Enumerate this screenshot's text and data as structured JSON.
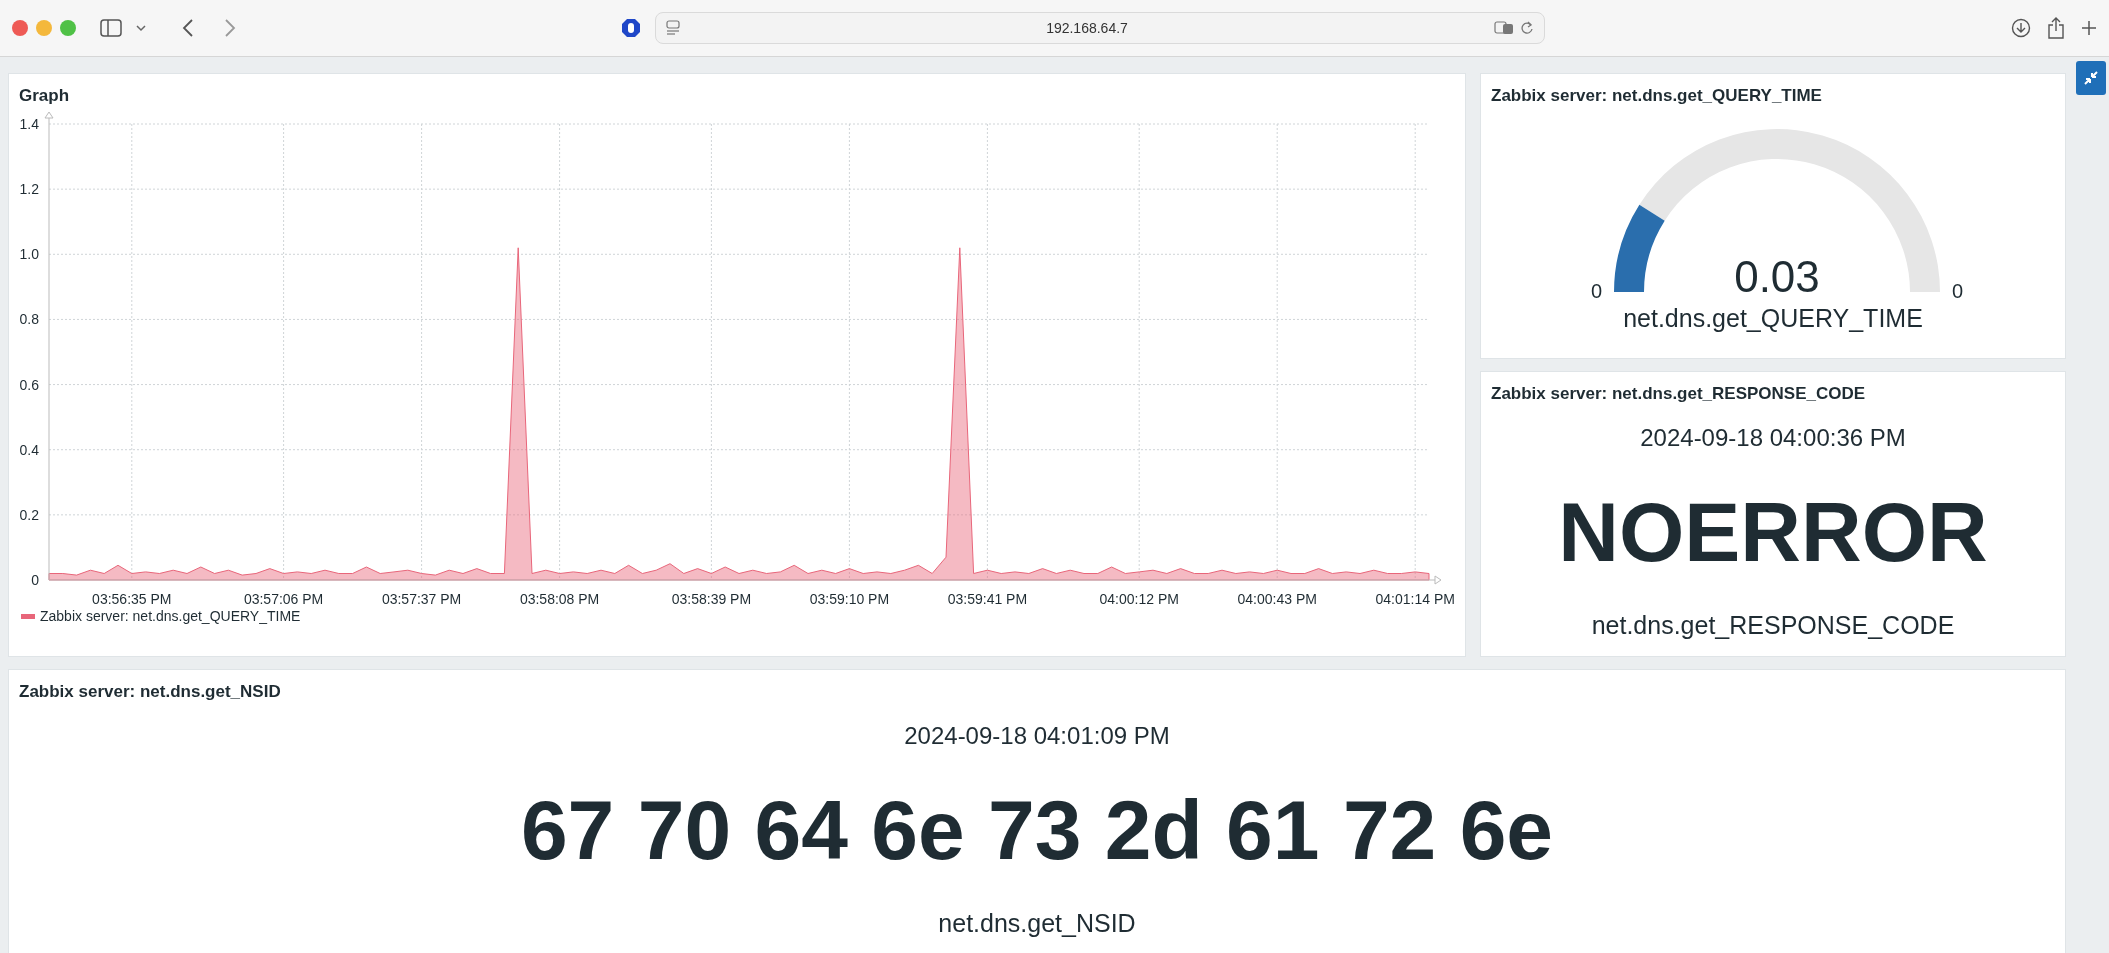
{
  "browser": {
    "url": "192.168.64.7"
  },
  "graph": {
    "title": "Graph",
    "chart_data": {
      "type": "area",
      "grid": true,
      "ylim": [
        0,
        1.4
      ],
      "categories": [
        null,
        null,
        null,
        null,
        null,
        null,
        "03:56:35 PM",
        null,
        null,
        null,
        null,
        null,
        null,
        null,
        null,
        null,
        null,
        "03:57:06 PM",
        null,
        null,
        null,
        null,
        null,
        null,
        null,
        null,
        null,
        "03:57:37 PM",
        null,
        null,
        null,
        null,
        null,
        null,
        null,
        null,
        null,
        "03:58:08 PM",
        null,
        null,
        null,
        null,
        null,
        null,
        null,
        null,
        null,
        null,
        "03:58:39 PM",
        null,
        null,
        null,
        null,
        null,
        null,
        null,
        null,
        null,
        "03:59:10 PM",
        null,
        null,
        null,
        null,
        null,
        null,
        null,
        null,
        null,
        "03:59:41 PM",
        null,
        null,
        null,
        null,
        null,
        null,
        null,
        null,
        null,
        null,
        "04:00:12 PM",
        null,
        null,
        null,
        null,
        null,
        null,
        null,
        null,
        null,
        "04:00:43 PM",
        null,
        null,
        null,
        null,
        null,
        null,
        null,
        null,
        null,
        "04:01:14 PM",
        null
      ],
      "yticks": [
        {
          "value": 0,
          "label": "0"
        },
        {
          "value": 0.2,
          "label": "0.2"
        },
        {
          "value": 0.4,
          "label": "0.4"
        },
        {
          "value": 0.6,
          "label": "0.6"
        },
        {
          "value": 0.8,
          "label": "0.8"
        },
        {
          "value": 1,
          "label": "1.0"
        },
        {
          "value": 1.2,
          "label": "1.2"
        },
        {
          "value": 1.4,
          "label": "1.4"
        }
      ],
      "series": [
        {
          "name": "Zabbix server: net.dns.get_QUERY_TIME",
          "color": "#e8667a",
          "values": [
            0.02,
            0.02,
            0.015,
            0.03,
            0.02,
            0.045,
            0.02,
            0.025,
            0.02,
            0.03,
            0.02,
            0.04,
            0.02,
            0.03,
            0.015,
            0.02,
            0.035,
            0.02,
            0.025,
            0.02,
            0.03,
            0.02,
            0.02,
            0.04,
            0.02,
            0.025,
            0.03,
            0.02,
            0.015,
            0.03,
            0.02,
            0.035,
            0.02,
            0.02,
            1.02,
            0.02,
            0.03,
            0.02,
            0.025,
            0.02,
            0.03,
            0.02,
            0.045,
            0.02,
            0.03,
            0.05,
            0.02,
            0.035,
            0.02,
            0.04,
            0.02,
            0.03,
            0.02,
            0.025,
            0.045,
            0.02,
            0.03,
            0.02,
            0.035,
            0.02,
            0.025,
            0.02,
            0.03,
            0.045,
            0.02,
            0.07,
            1.02,
            0.02,
            0.03,
            0.02,
            0.025,
            0.02,
            0.035,
            0.02,
            0.03,
            0.02,
            0.02,
            0.04,
            0.02,
            0.025,
            0.03,
            0.02,
            0.035,
            0.02,
            0.02,
            0.03,
            0.02,
            0.025,
            0.02,
            0.03,
            0.02,
            0.02,
            0.035,
            0.02,
            0.025,
            0.02,
            0.03,
            0.02,
            0.02,
            0.025,
            0.02
          ]
        }
      ]
    }
  },
  "gauge": {
    "title": "Zabbix server: net.dns.get_QUERY_TIME",
    "min": "0",
    "max": "0",
    "value": "0.03",
    "item": "net.dns.get_QUERY_TIME"
  },
  "response_code": {
    "title": "Zabbix server: net.dns.get_RESPONSE_CODE",
    "timestamp": "2024-09-18 04:00:36 PM",
    "value": "NOERROR",
    "item": "net.dns.get_RESPONSE_CODE"
  },
  "nsid": {
    "title": "Zabbix server: net.dns.get_NSID",
    "timestamp": "2024-09-18 04:01:09 PM",
    "value": "67 70 64 6e 73 2d 61 72 6e",
    "item": "net.dns.get_NSID"
  }
}
